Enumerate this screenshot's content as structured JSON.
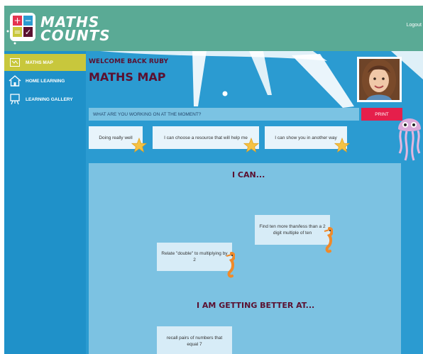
{
  "app": {
    "logo_line1": "MATHS",
    "logo_line2": "COUNTS",
    "logout_label": "Logout"
  },
  "sidebar": {
    "items": [
      {
        "label": "MATHS MAP",
        "icon": "map-icon",
        "active": true
      },
      {
        "label": "HOME LEARNING",
        "icon": "home-icon",
        "active": false
      },
      {
        "label": "LEARNING GALLERY",
        "icon": "easel-icon",
        "active": false
      }
    ]
  },
  "main": {
    "welcome": "WELCOME BACK RUBY",
    "title": "MATHS MAP",
    "question": "WHAT ARE YOU WORKING ON AT THE MOMENT?",
    "print_label": "PRINT",
    "choices": [
      "Doing really well",
      "I can choose a resource that will help me",
      "I can show you in another way"
    ],
    "section_can": "I CAN...",
    "can_cards": [
      "Find ten more than/less than a 2 digit multiple of ten",
      "Relate \"double\" to multiplying by 2"
    ],
    "section_better": "I AM GETTING BETTER AT...",
    "better_cards": [
      "recall pairs of numbers that equal 7"
    ]
  },
  "colors": {
    "header": "#5aaa95",
    "sidebar": "#1f91c9",
    "active_nav": "#c8c73c",
    "content_bg": "#2b9bd1",
    "panel": "#7cc2e2",
    "print": "#e51f4b",
    "heading": "#5a1030"
  }
}
